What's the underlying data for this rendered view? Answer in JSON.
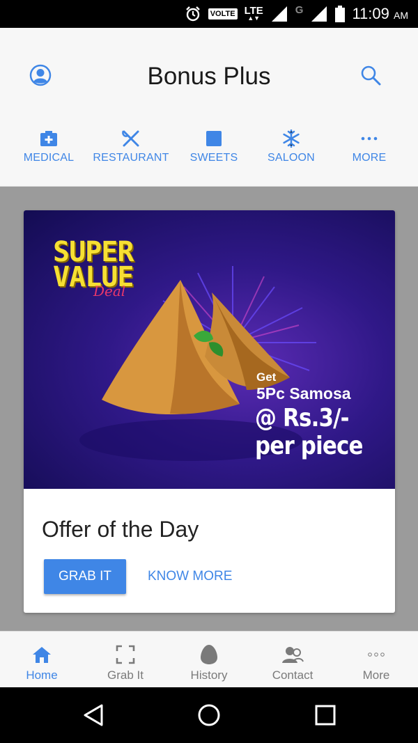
{
  "status_bar": {
    "volte": "VOLTE",
    "lte": "LTE",
    "g": "G",
    "time": "11:09",
    "ampm": "AM",
    "icons": [
      "alarm-icon",
      "signal-icon",
      "battery-icon"
    ]
  },
  "header": {
    "title": "Bonus Plus",
    "icons": [
      "profile-icon",
      "search-icon"
    ]
  },
  "categories": [
    {
      "label": "MEDICAL",
      "icon": "medical-kit-icon"
    },
    {
      "label": "RESTAURANT",
      "icon": "fork-knife-icon"
    },
    {
      "label": "SWEETS",
      "icon": "square-icon"
    },
    {
      "label": "SALOON",
      "icon": "snowflake-icon"
    },
    {
      "label": "MORE",
      "icon": "more-dots-icon"
    }
  ],
  "offer_card": {
    "banner": {
      "headline_line1": "SUPER",
      "headline_line2": "VALUE",
      "headline_script": "Deal",
      "get": "Get",
      "quantity": "5Pc Samosa",
      "price": "@ Rs.3/-",
      "per": "per piece"
    },
    "title": "Offer of the Day",
    "primary_button": "GRAB IT",
    "secondary_button": "KNOW MORE"
  },
  "bottom_nav": [
    {
      "label": "Home",
      "icon": "home-icon",
      "active": true
    },
    {
      "label": "Grab It",
      "icon": "scan-frame-icon",
      "active": false
    },
    {
      "label": "History",
      "icon": "egg-icon",
      "active": false
    },
    {
      "label": "Contact",
      "icon": "contacts-icon",
      "active": false
    },
    {
      "label": "More",
      "icon": "more-dots-icon",
      "active": false
    }
  ],
  "colors": {
    "accent": "#3f86e6",
    "inactive": "#7a7a7a",
    "banner_bg": "#2f1887",
    "headline": "#f6e033"
  }
}
